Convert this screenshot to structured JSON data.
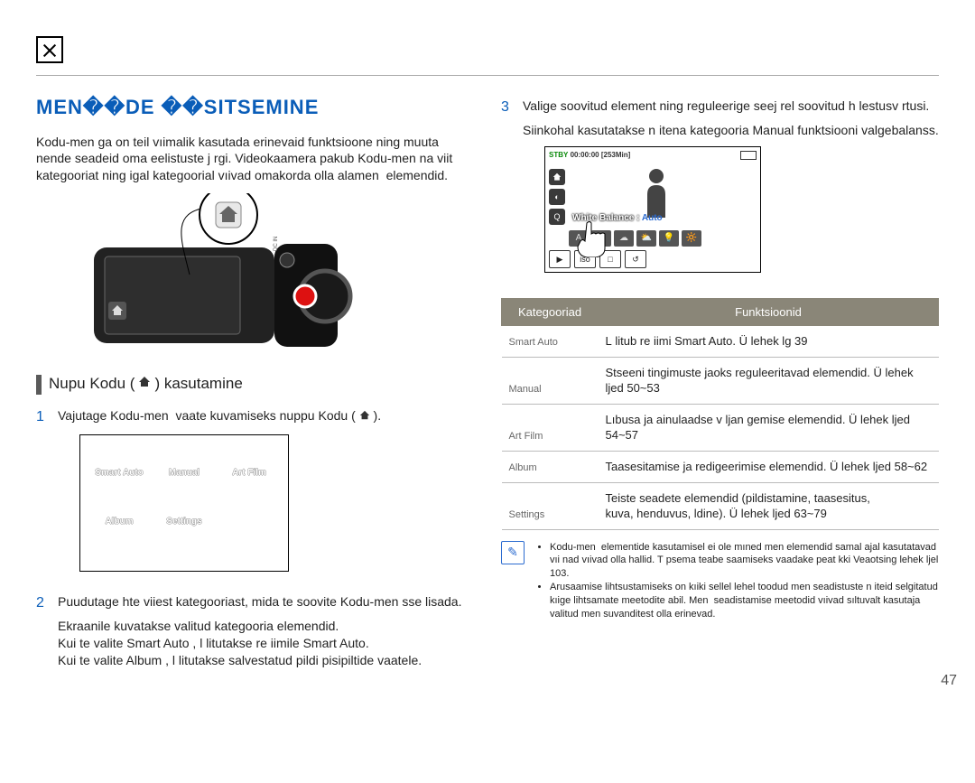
{
  "page_number": "47",
  "title": "MEN��DE ��SITSEMINE",
  "intro": "Kodu-men ga on teil vıimalik kasutada erinevaid funktsioone ning muuta nende seadeid oma eelistuste j rgi. Videokaamera pakub Kodu-men na viit kategooriat ning igal kategoorial vıivad omakorda olla alamen  elemendid.",
  "subheading_prefix": "Nupu Kodu (",
  "subheading_suffix": ") kasutamine",
  "steps": {
    "s1": {
      "text_a": "Vajutage Kodu-men  vaate kuvamiseks nuppu ",
      "kodu": "Kodu",
      "text_b": " ( ",
      "text_c": " )."
    },
    "s2": {
      "text": "Puudutage hte viiest kategooriast, mida te soovite Kodu-men sse lisada.",
      "sub1": "Ekraanile kuvatakse valitud kategooria elemendid.",
      "sub2a": "Kui te valite ",
      "sub2_term": "Smart Auto",
      "sub2b": " , l litutakse re iimile Smart Auto.",
      "sub3a": "Kui te valite ",
      "sub3_term": "Album",
      "sub3b": " , l litutakse salvestatud pildi pisipiltide vaatele."
    },
    "s3": {
      "text": "Valige soovitud element ning reguleerige seej rel soovitud h lestusv rtusi.",
      "sub": "Siinkohal kasutatakse n itena kategooria Manual funktsiooni valgebalanss."
    }
  },
  "menu_panel": {
    "items": [
      "Smart Auto",
      "Manual",
      "Art Film",
      "Album",
      "Settings"
    ]
  },
  "screen_preview": {
    "stby": "STBY",
    "time": "00:00:00",
    "remain": "[253Min]",
    "wb_label": "White Balance : ",
    "wb_value": "Auto",
    "options": [
      "A",
      "☀",
      "☁",
      "⛅",
      "💡",
      "🔆"
    ],
    "bottom": [
      "▶",
      "iso",
      "□",
      "↺"
    ]
  },
  "table": {
    "head_cat": "Kategooriad",
    "head_func": "Funktsioonid",
    "rows": [
      {
        "cat": "Smart Auto",
        "desc": "L litub re iimi Smart Auto. Ü lehek lg 39"
      },
      {
        "cat": "Manual",
        "desc": "Stseeni tingimuste jaoks reguleeritavad elemendid. Ü lehek ljed 50~53"
      },
      {
        "cat": "Art Film",
        "desc": "Lıbusa ja ainulaadse v ljan gemise elemendid. Ü lehek ljed 54~57"
      },
      {
        "cat": "Album",
        "desc": "Taasesitamise ja redigeerimise elemendid. Ü lehek ljed 58~62"
      },
      {
        "cat": "Settings",
        "desc": "Teiste seadete elemendid (pildistamine, taasesitus, kuva, henduvus, ldine). Ü lehek ljed 63~79"
      }
    ]
  },
  "info_note": {
    "items": [
      "Kodu-men  elementide kasutamisel ei ole mıned men elemendid samal ajal kasutatavad vıi nad vıivad olla hallid. T psema teabe saamiseks vaadake peat kki Veaotsing lehek ljel 103.",
      "Arusaamise lihtsustamiseks on kıiki sellel lehel toodud men seadistuste n iteid selgitatud kıige lihtsamate meetodite abil. Men  seadistamise meetodid vıivad sıltuvalt kasutaja valitud men suvanditest olla erinevad."
    ]
  }
}
